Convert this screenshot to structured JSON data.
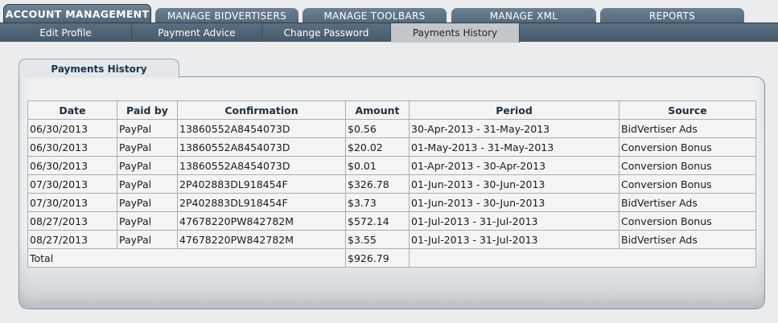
{
  "main_tabs": [
    {
      "label": "ACCOUNT MANAGEMENT",
      "active": true
    },
    {
      "label": "MANAGE BIDVERTISERS",
      "active": false
    },
    {
      "label": "MANAGE TOOLBARS",
      "active": false
    },
    {
      "label": "MANAGE XML",
      "active": false
    },
    {
      "label": "REPORTS",
      "active": false
    }
  ],
  "sub_tabs": [
    {
      "label": "Edit Profile",
      "active": false
    },
    {
      "label": "Payment Advice",
      "active": false
    },
    {
      "label": "Change Password",
      "active": false
    },
    {
      "label": "Payments History",
      "active": true
    }
  ],
  "panel": {
    "title": "Payments History"
  },
  "table": {
    "headers": [
      "Date",
      "Paid by",
      "Confirmation",
      "Amount",
      "Period",
      "Source"
    ],
    "rows": [
      [
        "06/30/2013",
        "PayPal",
        "13860552A8454073D",
        "$0.56",
        "30-Apr-2013 - 31-May-2013",
        "BidVertiser Ads"
      ],
      [
        "06/30/2013",
        "PayPal",
        "13860552A8454073D",
        "$20.02",
        "01-May-2013 - 31-May-2013",
        "Conversion Bonus"
      ],
      [
        "06/30/2013",
        "PayPal",
        "13860552A8454073D",
        "$0.01",
        "01-Apr-2013 - 30-Apr-2013",
        "Conversion Bonus"
      ],
      [
        "07/30/2013",
        "PayPal",
        "2P402883DL918454F",
        "$326.78",
        "01-Jun-2013 - 30-Jun-2013",
        "Conversion Bonus"
      ],
      [
        "07/30/2013",
        "PayPal",
        "2P402883DL918454F",
        "$3.73",
        "01-Jun-2013 - 30-Jun-2013",
        "BidVertiser Ads"
      ],
      [
        "08/27/2013",
        "PayPal",
        "47678220PW842782M",
        "$572.14",
        "01-Jul-2013 - 31-Jul-2013",
        "Conversion Bonus"
      ],
      [
        "08/27/2013",
        "PayPal",
        "47678220PW842782M",
        "$3.55",
        "01-Jul-2013 - 31-Jul-2013",
        "BidVertiser Ads"
      ]
    ],
    "total_label": "Total",
    "total_amount": "$926.79"
  }
}
